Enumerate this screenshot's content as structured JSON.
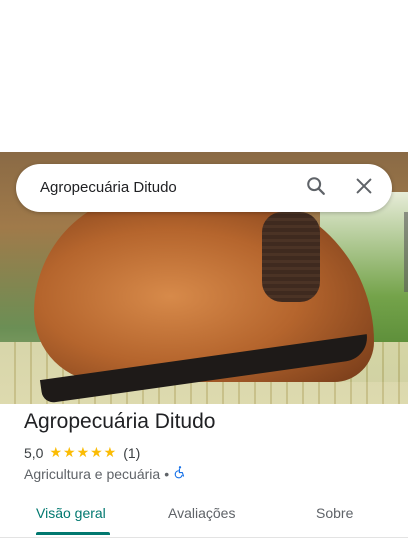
{
  "search": {
    "query": "Agropecuária Ditudo"
  },
  "place": {
    "name": "Agropecuária Ditudo",
    "rating": "5,0",
    "stars": "★★★★★",
    "review_count": "(1)",
    "category": "Agricultura e pecuária",
    "separator": "•"
  },
  "tabs": [
    {
      "label": "Visão geral",
      "active": true
    },
    {
      "label": "Avaliações",
      "active": false
    },
    {
      "label": "Sobre",
      "active": false
    }
  ],
  "colors": {
    "accent": "#01786f",
    "star": "#fbbc04",
    "accessibility": "#1a73e8"
  },
  "icons": {
    "search": "search-icon",
    "close": "close-icon",
    "accessibility": "wheelchair-icon"
  }
}
